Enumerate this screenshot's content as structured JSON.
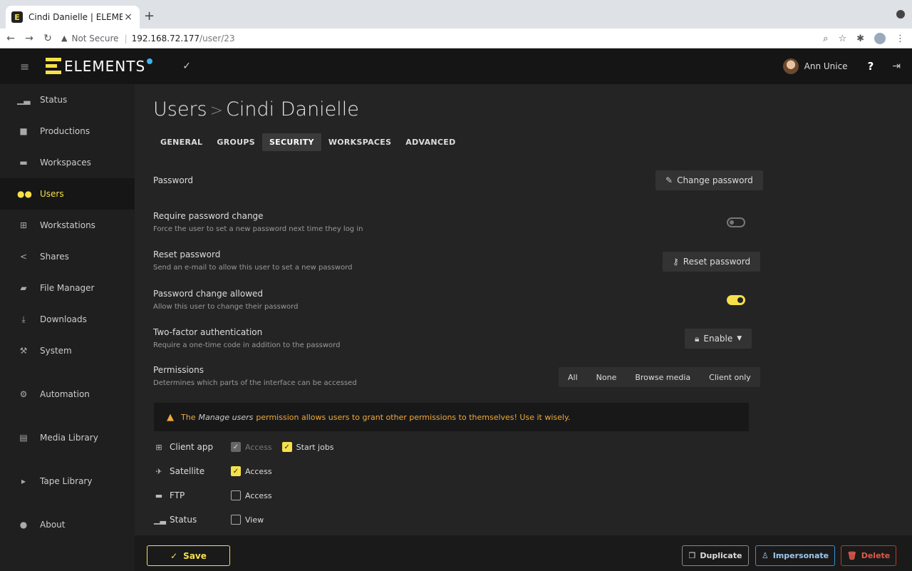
{
  "browser": {
    "tab_title": "Cindi Danielle | ELEMENTS",
    "tab_close": "×",
    "new_tab": "+",
    "not_secure": "Not Secure",
    "url_host": "192.168.72.177",
    "url_path": "/user/23"
  },
  "app": {
    "logo_text": "ELEMENTS",
    "user_name": "Ann Unice",
    "help": "?"
  },
  "sidebar": {
    "items": [
      {
        "label": "Status",
        "icon": "chart-icon"
      },
      {
        "label": "Productions",
        "icon": "briefcase-icon"
      },
      {
        "label": "Workspaces",
        "icon": "folder-icon"
      },
      {
        "label": "Users",
        "icon": "users-icon",
        "active": true
      },
      {
        "label": "Workstations",
        "icon": "network-icon"
      },
      {
        "label": "Shares",
        "icon": "share-icon"
      },
      {
        "label": "File Manager",
        "icon": "folders-icon"
      },
      {
        "label": "Downloads",
        "icon": "download-icon"
      },
      {
        "label": "System",
        "icon": "wrench-icon"
      },
      {
        "label": "Automation",
        "icon": "cogs-icon"
      },
      {
        "label": "Media Library",
        "icon": "film-icon"
      },
      {
        "label": "Tape Library",
        "icon": "chevron-right-icon"
      },
      {
        "label": "About",
        "icon": "info-icon"
      }
    ]
  },
  "page": {
    "breadcrumb_parent": "Users",
    "breadcrumb_sep": ">",
    "breadcrumb_current": "Cindi Danielle",
    "tabs": [
      "GENERAL",
      "GROUPS",
      "SECURITY",
      "WORKSPACES",
      "ADVANCED"
    ],
    "active_tab": "SECURITY"
  },
  "security": {
    "password_label": "Password",
    "change_password_btn": "Change password",
    "require_change_title": "Require password change",
    "require_change_desc": "Force the user to set a new password next time they log in",
    "require_change_value": false,
    "reset_title": "Reset password",
    "reset_desc": "Send an e-mail to allow this user to set a new password",
    "reset_btn": "Reset password",
    "change_allowed_title": "Password change allowed",
    "change_allowed_desc": "Allow this user to change their password",
    "change_allowed_value": true,
    "twofa_title": "Two-factor authentication",
    "twofa_desc": "Require a one-time code in addition to the password",
    "twofa_btn": "Enable",
    "permissions_title": "Permissions",
    "permissions_desc": "Determines which parts of the interface can be accessed",
    "permission_presets": [
      "All",
      "None",
      "Browse media",
      "Client only"
    ]
  },
  "warning": {
    "prefix": "The",
    "emphasis": "Manage users",
    "suffix": "permission allows users to grant other permissions to themselves! Use it wisely."
  },
  "permissions": [
    {
      "label": "Client app",
      "icon": "network-icon",
      "options": [
        {
          "label": "Access",
          "state": "disabled"
        },
        {
          "label": "Start jobs",
          "state": "checked"
        }
      ]
    },
    {
      "label": "Satellite",
      "icon": "satellite-icon",
      "options": [
        {
          "label": "Access",
          "state": "checked"
        }
      ]
    },
    {
      "label": "FTP",
      "icon": "folder-icon",
      "options": [
        {
          "label": "Access",
          "state": "unchecked"
        }
      ]
    },
    {
      "label": "Status",
      "icon": "chart-icon",
      "options": [
        {
          "label": "View",
          "state": "unchecked"
        }
      ]
    }
  ],
  "footer": {
    "save": "Save",
    "duplicate": "Duplicate",
    "impersonate": "Impersonate",
    "delete": "Delete"
  },
  "colors": {
    "accent": "#f5e04a",
    "warning": "#f0a93a",
    "info": "#3b8fd6",
    "danger": "#c0392b"
  }
}
